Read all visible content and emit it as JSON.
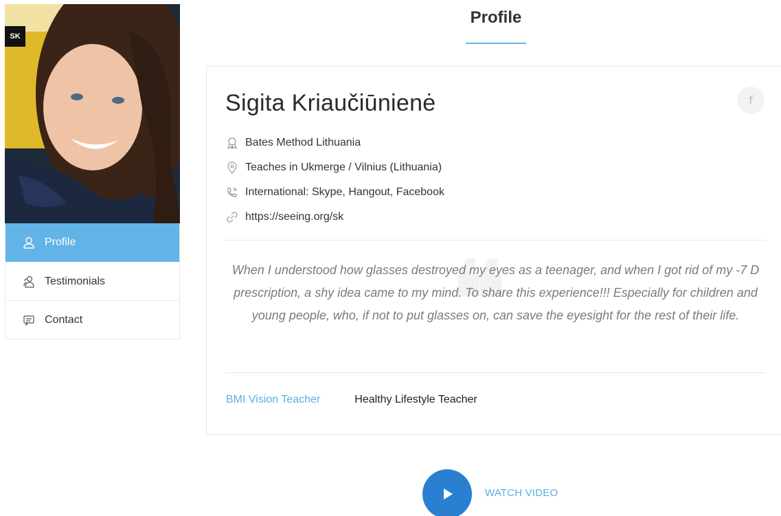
{
  "photo": {
    "initials": "SK"
  },
  "sidebar": {
    "items": [
      {
        "label": "Profile",
        "icon": "user-icon",
        "active": true
      },
      {
        "label": "Testimonials",
        "icon": "users-icon",
        "active": false
      },
      {
        "label": "Contact",
        "icon": "chat-icon",
        "active": false
      }
    ]
  },
  "header": {
    "title": "Profile"
  },
  "profile": {
    "name": "Sigita Kriaučiūnienė",
    "social": {
      "icon": "facebook-icon",
      "glyph": "f"
    },
    "info": [
      {
        "icon": "award-icon",
        "text": "Bates Method Lithuania"
      },
      {
        "icon": "location-pin-icon",
        "text": "Teaches in Ukmerge / Vilnius (Lithuania)"
      },
      {
        "icon": "phone-icon",
        "text": "International: Skype, Hangout, Facebook"
      },
      {
        "icon": "link-icon",
        "text": "https://seeing.org/sk"
      }
    ],
    "quote": "When I understood how glasses destroyed my eyes as a teenager, and when I got rid of my -7 D prescription, a shy idea came to my mind. To share this experience!!! Especially for children and young people, who, if not to put glasses on, can save the eyesight for the rest of their life.",
    "tags": {
      "primary": "BMI Vision Teacher",
      "secondary": "Healthy Lifestyle Teacher"
    }
  },
  "video": {
    "label": "WATCH VIDEO"
  },
  "colors": {
    "accent": "#62b4e8",
    "link": "#5aaee3",
    "play": "#2b7fd1"
  }
}
